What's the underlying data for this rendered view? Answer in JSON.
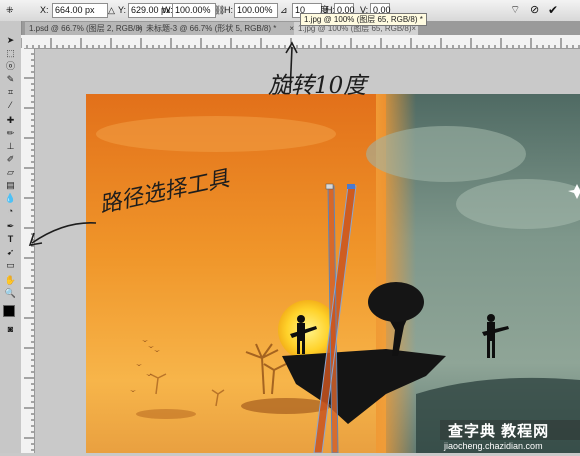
{
  "options_bar": {
    "x_label": "X:",
    "x_value": "664.00 px",
    "y_label": "Y:",
    "y_value": "629.00 px",
    "w_label": "W:",
    "w_value": "100.00%",
    "h_label": "H:",
    "h_value": "100.00%",
    "angle_value": "10",
    "angle_unit": "度",
    "h_label2": "H:",
    "h_value2": "0.00",
    "v_label": "V:",
    "v_value": "0.00"
  },
  "tooltip": "1.jpg @ 100% (图层 65, RGB/8) *",
  "tabs": [
    {
      "label": "1.psd @ 66.7% (图层 2, RGB/8) *"
    },
    {
      "label": "未标题-3 @ 66.7% (形状 5, RGB/8) *"
    },
    {
      "label": "1.jpg @ 100% (图层 65, RGB/8)"
    }
  ],
  "annotations": {
    "rotate": "旋转10度",
    "path_tool": "路径选择工具"
  },
  "watermark": {
    "text": "查字典 教程网",
    "url": "jiaocheng.chazidian.com"
  },
  "colors": {
    "sunset_orange": "#e8821a",
    "teal_sky": "#6f8a7c",
    "path_line": "#c9541e"
  }
}
